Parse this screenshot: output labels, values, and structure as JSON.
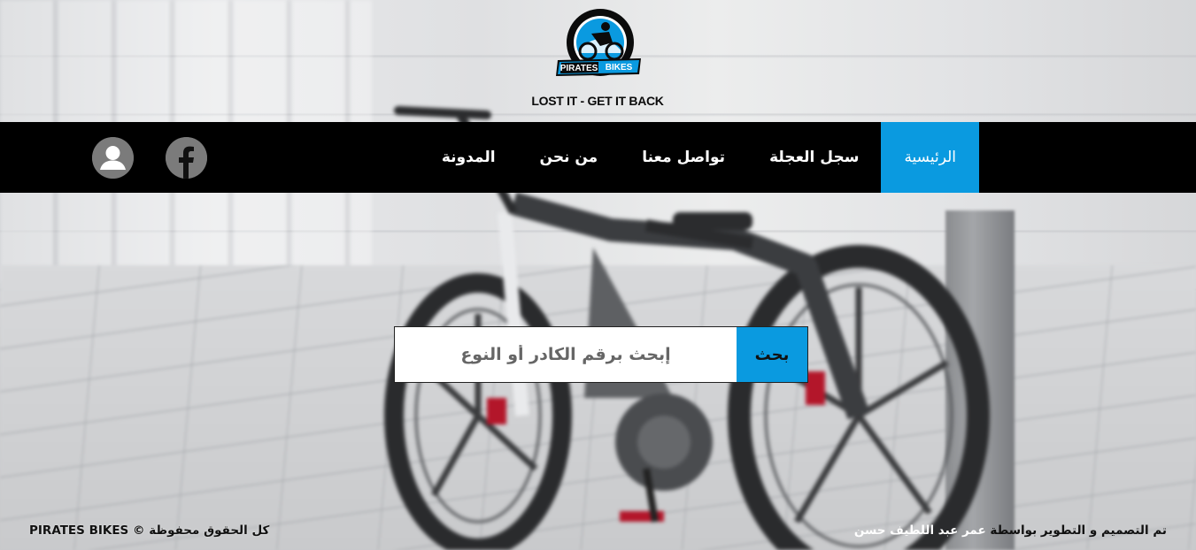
{
  "brand": {
    "logo_top": "PIRATES",
    "logo_bottom": "BIKES",
    "tagline": "LOST IT - GET IT BACK"
  },
  "nav": {
    "items": [
      {
        "label": "الرئيسية",
        "active": true
      },
      {
        "label": "سجل العجلة",
        "active": false
      },
      {
        "label": "تواصل معنا",
        "active": false
      },
      {
        "label": "من نحن",
        "active": false
      },
      {
        "label": "المدونة",
        "active": false
      }
    ],
    "icons": [
      "facebook-icon",
      "user-icon"
    ]
  },
  "search": {
    "button_label": "بحث",
    "placeholder": "إبحث برقم الكادر أو النوع"
  },
  "footer": {
    "credit_prefix": "تم التصميم و التطوير بواسطة",
    "credit_author": "عمر عبد اللطيف حسن",
    "copyright": "كل الحقوق محفوظة © PIRATES BIKES"
  },
  "colors": {
    "accent": "#0a9ae0",
    "nav_bg": "#000000"
  }
}
